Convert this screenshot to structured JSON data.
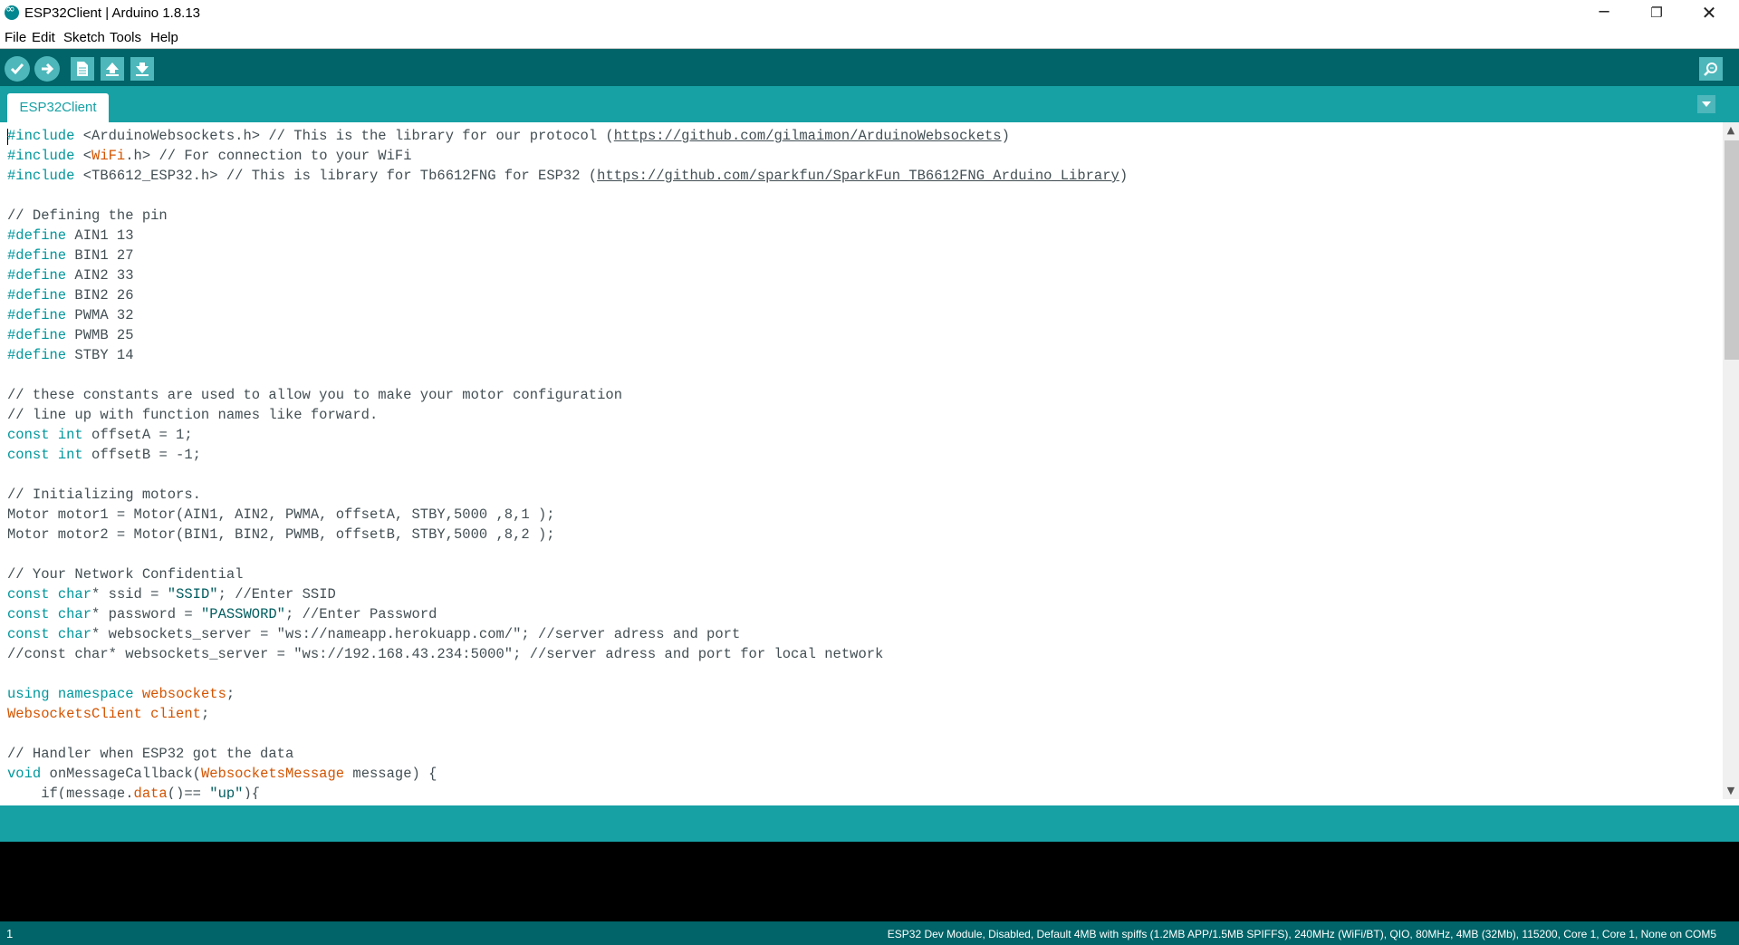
{
  "window": {
    "title": "ESP32Client | Arduino 1.8.13",
    "minimize": "─",
    "maximize": "❐",
    "close": "✕"
  },
  "menu": [
    {
      "label": "File"
    },
    {
      "label": "Edit"
    },
    {
      "label": "Sketch"
    },
    {
      "label": "Tools"
    },
    {
      "label": "Help"
    }
  ],
  "toolbar": {
    "buttons": [
      "verify",
      "upload",
      "new",
      "open",
      "save"
    ],
    "serial_monitor": "serial-monitor"
  },
  "tabs": [
    {
      "label": "ESP32Client",
      "active": true
    }
  ],
  "editor": {
    "lines": [
      "#include <ArduinoWebsockets.h> // This is the library for our protocol (https://github.com/gilmaimon/ArduinoWebsockets)",
      "#include <WiFi.h> // For connection to your WiFi",
      "#include <TB6612_ESP32.h> // This is library for Tb6612FNG for ESP32 (https://github.com/sparkfun/SparkFun_TB6612FNG_Arduino_Library)",
      "",
      "// Defining the pin",
      "#define AIN1 13",
      "#define BIN1 27",
      "#define AIN2 33",
      "#define BIN2 26",
      "#define PWMA 32",
      "#define PWMB 25",
      "#define STBY 14",
      "",
      "// these constants are used to allow you to make your motor configuration",
      "// line up with function names like forward.",
      "const int offsetA = 1;",
      "const int offsetB = -1;",
      "",
      "// Initializing motors.",
      "Motor motor1 = Motor(AIN1, AIN2, PWMA, offsetA, STBY,5000 ,8,1 );",
      "Motor motor2 = Motor(BIN1, BIN2, PWMB, offsetB, STBY,5000 ,8,2 );",
      "",
      "// Your Network Confidential",
      "const char* ssid = \"SSID\"; //Enter SSID",
      "const char* password = \"PASSWORD\"; //Enter Password",
      "const char* websockets_server = \"ws://nameapp.herokuapp.com/\"; //server adress and port",
      "//const char* websockets_server = \"ws://192.168.43.234:5000\"; //server adress and port for local network",
      "",
      "using namespace websockets;",
      "WebsocketsClient client;",
      "",
      "// Handler when ESP32 got the data",
      "void onMessageCallback(WebsocketsMessage message) {",
      "    if(message.data()== \"up\"){"
    ]
  },
  "status": {
    "line_number": "1",
    "board_info": "ESP32 Dev Module, Disabled, Default 4MB with spiffs (1.2MB APP/1.5MB SPIFFS), 240MHz (WiFi/BT), QIO, 80MHz, 4MB (32Mb), 115200, Core 1, Core 1, None on COM5"
  },
  "colors": {
    "toolbar": "#006468",
    "tabbar": "#17a1a5",
    "keyword": "#00979c",
    "type": "#d35400"
  }
}
